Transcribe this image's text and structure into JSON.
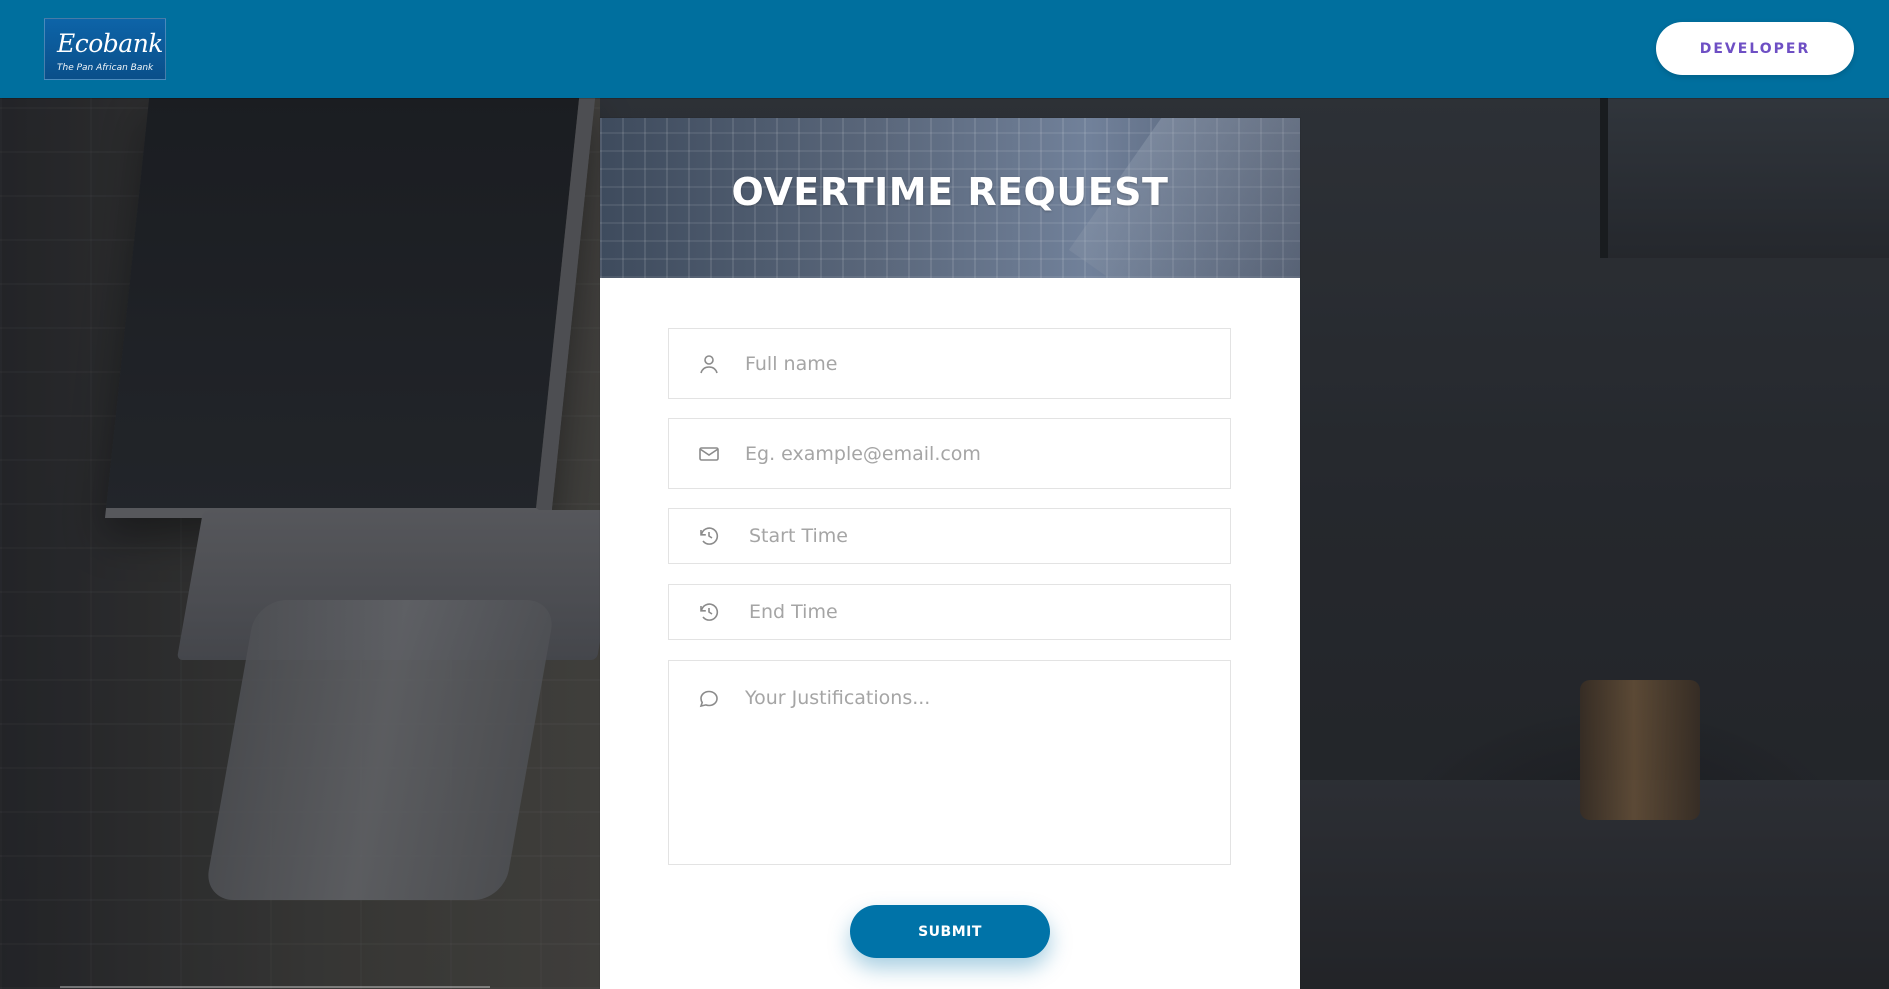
{
  "header": {
    "brand_name": "Ecobank",
    "brand_tagline": "The Pan African Bank",
    "developer_label": "DEVELOPER",
    "background_color": "#006f9e",
    "developer_text_color": "#6e4fc4"
  },
  "form": {
    "title": "OVERTIME REQUEST",
    "fields": {
      "full_name": {
        "placeholder": "Full name",
        "icon": "user-icon"
      },
      "email": {
        "placeholder": "Eg. example@email.com",
        "icon": "mail-icon"
      },
      "start_time": {
        "placeholder": "Start Time",
        "icon": "history-icon"
      },
      "end_time": {
        "placeholder": "End Time",
        "icon": "history-icon"
      },
      "justifications": {
        "placeholder": "Your Justifications...",
        "icon": "chat-icon"
      }
    },
    "submit_label": "SUBMIT",
    "submit_color": "#0073a8"
  }
}
